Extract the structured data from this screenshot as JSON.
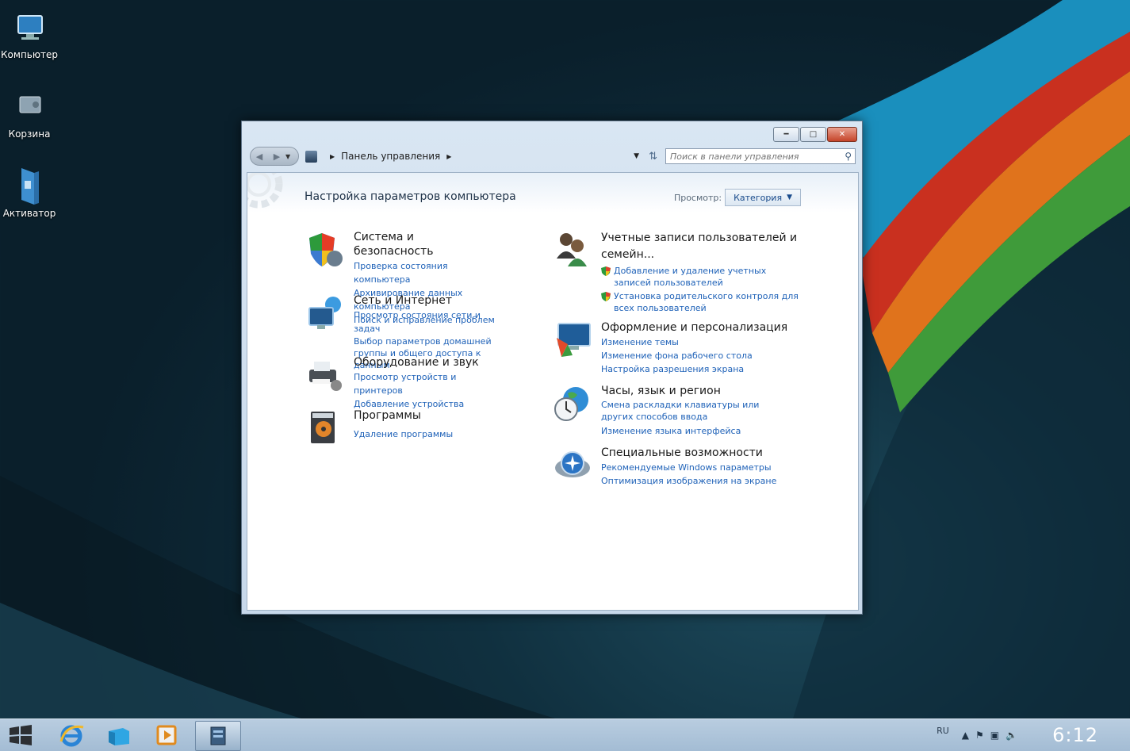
{
  "desktop": {
    "icons": [
      {
        "label": "Компьютер"
      },
      {
        "label": "Корзина"
      },
      {
        "label": "Активатор"
      }
    ]
  },
  "window": {
    "breadcrumb": {
      "root": "Панель управления"
    },
    "search": {
      "placeholder": "Поиск в панели управления"
    },
    "page_title": "Настройка параметров компьютера",
    "view": {
      "label": "Просмотр:",
      "value": "Категория"
    },
    "left_categories": [
      {
        "title": "Система и безопасность",
        "links": [
          "Проверка состояния компьютера",
          "Архивирование данных компьютера",
          "Поиск и исправление проблем"
        ]
      },
      {
        "title": "Сеть и Интернет",
        "links": [
          "Просмотр состояния сети и задач",
          "Выбор параметров домашней группы и общего доступа к данным"
        ]
      },
      {
        "title": "Оборудование и звук",
        "links": [
          "Просмотр устройств и принтеров",
          "Добавление устройства"
        ]
      },
      {
        "title": "Программы",
        "links": [
          "Удаление программы"
        ]
      }
    ],
    "right_categories": [
      {
        "title": "Учетные записи пользователей и семейн...",
        "links": [
          "Добавление и удаление учетных записей пользователей",
          "Установка родительского контроля для всех пользователей"
        ]
      },
      {
        "title": "Оформление и персонализация",
        "links": [
          "Изменение темы",
          "Изменение фона рабочего стола",
          "Настройка разрешения экрана"
        ]
      },
      {
        "title": "Часы, язык и регион",
        "links": [
          "Смена раскладки клавиатуры или других способов ввода",
          "Изменение языка интерфейса"
        ]
      },
      {
        "title": "Специальные возможности",
        "links": [
          "Рекомендуемые Windows параметры",
          "Оптимизация изображения на экране"
        ]
      }
    ]
  },
  "taskbar": {
    "language": "RU",
    "clock": "6:12"
  }
}
